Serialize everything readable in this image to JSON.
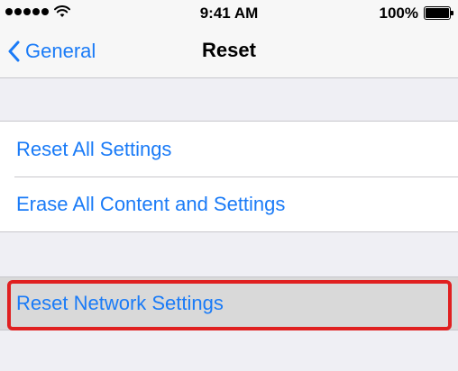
{
  "status_bar": {
    "time": "9:41 AM",
    "battery_percent": "100%",
    "signal_bars": 5,
    "battery_level": 1.0
  },
  "nav": {
    "back_label": "General",
    "title": "Reset"
  },
  "settings": {
    "items": [
      {
        "label": "Reset All Settings"
      },
      {
        "label": "Erase All Content and Settings"
      },
      {
        "label": "Reset Network Settings"
      }
    ]
  },
  "colors": {
    "accent": "#1a7bf7",
    "highlight": "#e02020",
    "background": "#efeff4",
    "selected_row": "#d9d9d9"
  }
}
